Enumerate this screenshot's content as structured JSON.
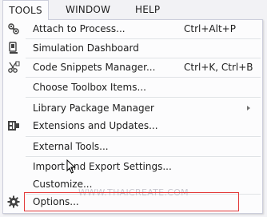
{
  "menubar": {
    "items": [
      {
        "label": "TOOLS"
      },
      {
        "label": "WINDOW"
      },
      {
        "label": "HELP"
      }
    ]
  },
  "menu": {
    "items": [
      {
        "label": "Attach to Process...",
        "shortcut": "Ctrl+Alt+P",
        "icon": "attach-process-icon"
      },
      {
        "label": "Simulation Dashboard",
        "shortcut": "",
        "icon": "simulation-dashboard-icon"
      },
      {
        "label": "Code Snippets Manager...",
        "shortcut": "Ctrl+K, Ctrl+B",
        "icon": "code-snippets-icon"
      },
      {
        "label": "Choose Toolbox Items...",
        "shortcut": "",
        "icon": ""
      },
      {
        "label": "Library Package Manager",
        "shortcut": "",
        "icon": "",
        "submenu": true
      },
      {
        "label": "Extensions and Updates...",
        "shortcut": "",
        "icon": "extensions-icon"
      },
      {
        "label": "External Tools...",
        "shortcut": "",
        "icon": ""
      },
      {
        "label": "Import and Export Settings...",
        "shortcut": "",
        "icon": ""
      },
      {
        "label": "Customize...",
        "shortcut": "",
        "icon": ""
      },
      {
        "label": "Options...",
        "shortcut": "",
        "icon": "gear-icon"
      }
    ]
  },
  "watermark": "WWW.THAICREATE.COM",
  "colors": {
    "menu_background": "#fcfcfd",
    "menu_border": "#cccedb",
    "highlight_border": "#e23a3a",
    "separator": "#e0e3e6"
  }
}
